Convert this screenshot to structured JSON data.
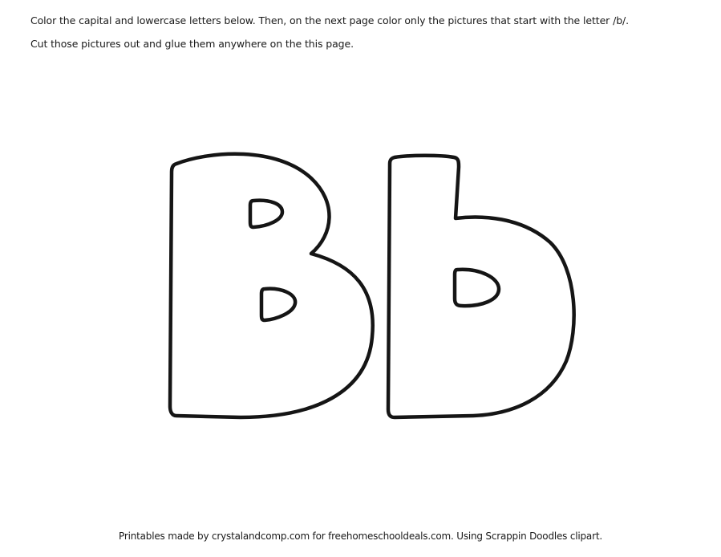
{
  "worksheet": {
    "instructions": [
      "Color the capital and lowercase letters below. Then, on the next page color only the pictures that start with the letter /b/.",
      "Cut those pictures out and glue them anywhere on the this page."
    ],
    "letters": {
      "uppercase": "B",
      "lowercase": "b"
    },
    "footer": "Printables made by crystalandcomp.com for freehomeschooldeals.com. Using Scrappin Doodles clipart."
  }
}
